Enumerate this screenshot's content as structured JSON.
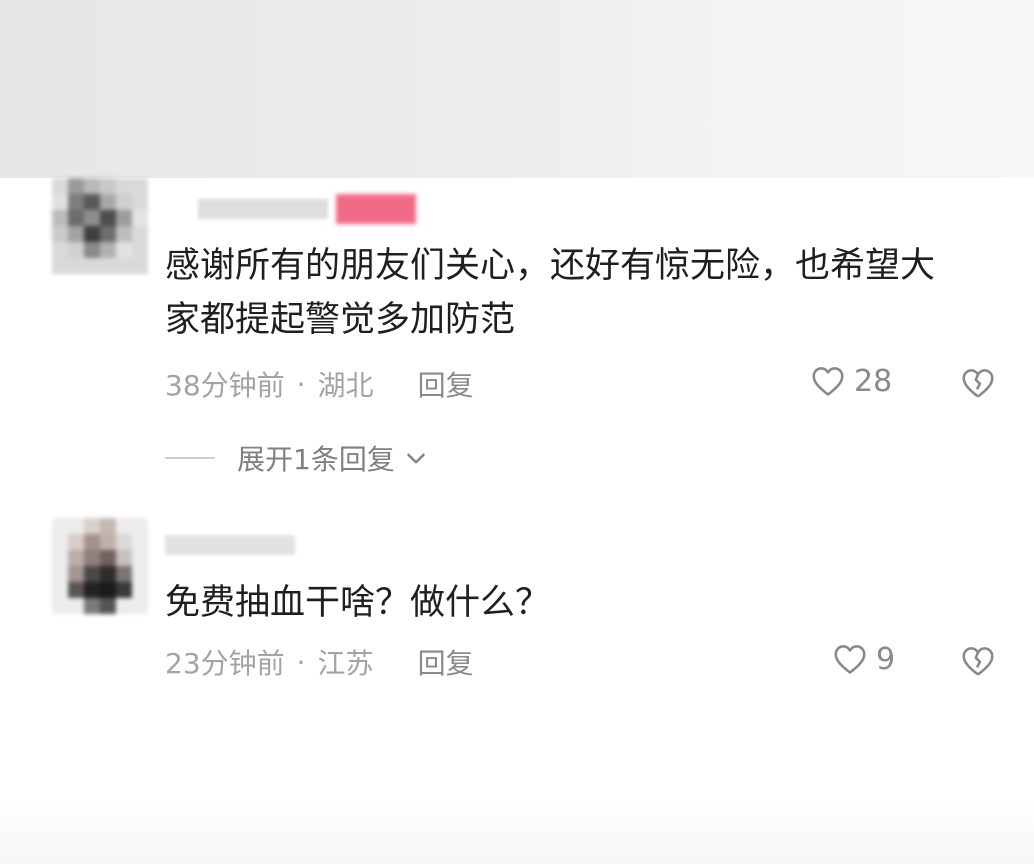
{
  "comments": [
    {
      "username": "",
      "text_line1": "感谢所有的朋友们关心，还好有惊无险，也希望大",
      "text_line2": "家都提起警觉多加防范",
      "time": "38分钟前",
      "separator": "·",
      "location": "湖北",
      "reply_label": "回复",
      "likes": "28",
      "like_icon": "heart-outline-icon",
      "dislike_icon": "broken-heart-icon",
      "expand_label": "展开1条回复"
    },
    {
      "username": "",
      "text_line1": "免费抽血干啥？做什么？",
      "time": "23分钟前",
      "separator": "·",
      "location": "江苏",
      "reply_label": "回复",
      "likes": "9",
      "like_icon": "heart-outline-icon",
      "dislike_icon": "broken-heart-icon"
    }
  ],
  "colors": {
    "text": "#1f1f1f",
    "meta": "#a3a3a3",
    "username_badge": "#f06b86"
  }
}
